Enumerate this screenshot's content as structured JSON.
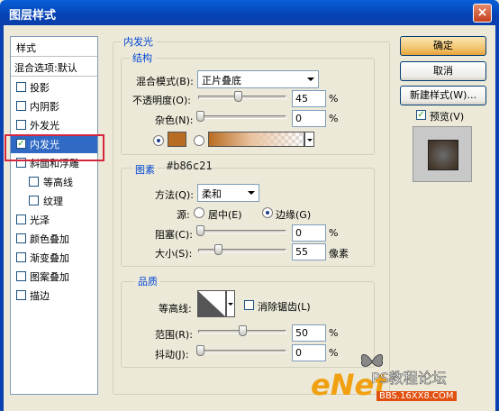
{
  "window": {
    "title": "图层样式",
    "close_label": "×"
  },
  "sidebar": {
    "header": "样式",
    "blend_options": "混合选项:默认",
    "items": [
      {
        "label": "投影",
        "checked": false,
        "sub": false
      },
      {
        "label": "内阴影",
        "checked": false,
        "sub": false
      },
      {
        "label": "外发光",
        "checked": false,
        "sub": false
      },
      {
        "label": "内发光",
        "checked": true,
        "sub": false,
        "selected": true
      },
      {
        "label": "斜面和浮雕",
        "checked": false,
        "sub": false
      },
      {
        "label": "等高线",
        "checked": false,
        "sub": true
      },
      {
        "label": "纹理",
        "checked": false,
        "sub": true
      },
      {
        "label": "光泽",
        "checked": false,
        "sub": false
      },
      {
        "label": "颜色叠加",
        "checked": false,
        "sub": false
      },
      {
        "label": "渐变叠加",
        "checked": false,
        "sub": false
      },
      {
        "label": "图案叠加",
        "checked": false,
        "sub": false
      },
      {
        "label": "描边",
        "checked": false,
        "sub": false
      }
    ]
  },
  "panel": {
    "title": "内发光",
    "structure": {
      "title": "结构",
      "blend_mode_label": "混合模式(B):",
      "blend_mode_value": "正片叠底",
      "opacity_label": "不透明度(O):",
      "opacity_value": "45",
      "noise_label": "杂色(N):",
      "noise_value": "0",
      "percent": "%",
      "color_hex": "#b86c21"
    },
    "elements": {
      "title": "图素",
      "annotation": "#b86c21",
      "method_label": "方法(Q):",
      "method_value": "柔和",
      "source_label": "源:",
      "source_center": "居中(E)",
      "source_edge": "边缘(G)",
      "choke_label": "阻塞(C):",
      "choke_value": "0",
      "size_label": "大小(S):",
      "size_value": "55",
      "size_unit": "像素",
      "percent": "%"
    },
    "quality": {
      "title": "品质",
      "contour_label": "等高线:",
      "antialias_label": "消除锯齿(L)",
      "range_label": "范围(R):",
      "range_value": "50",
      "jitter_label": "抖动(J):",
      "jitter_value": "0",
      "percent": "%"
    }
  },
  "buttons": {
    "ok": "确定",
    "cancel": "取消",
    "new_style": "新建样式(W)...",
    "preview_label": "预览(V)"
  },
  "watermark": {
    "brand": "eNet",
    "subtitle": "PS教程论坛",
    "url": "BBS.16XX8.COM"
  },
  "colors": {
    "glow": "#b86c21",
    "title_bar": "#0542b5",
    "selected": "#316ac5"
  }
}
